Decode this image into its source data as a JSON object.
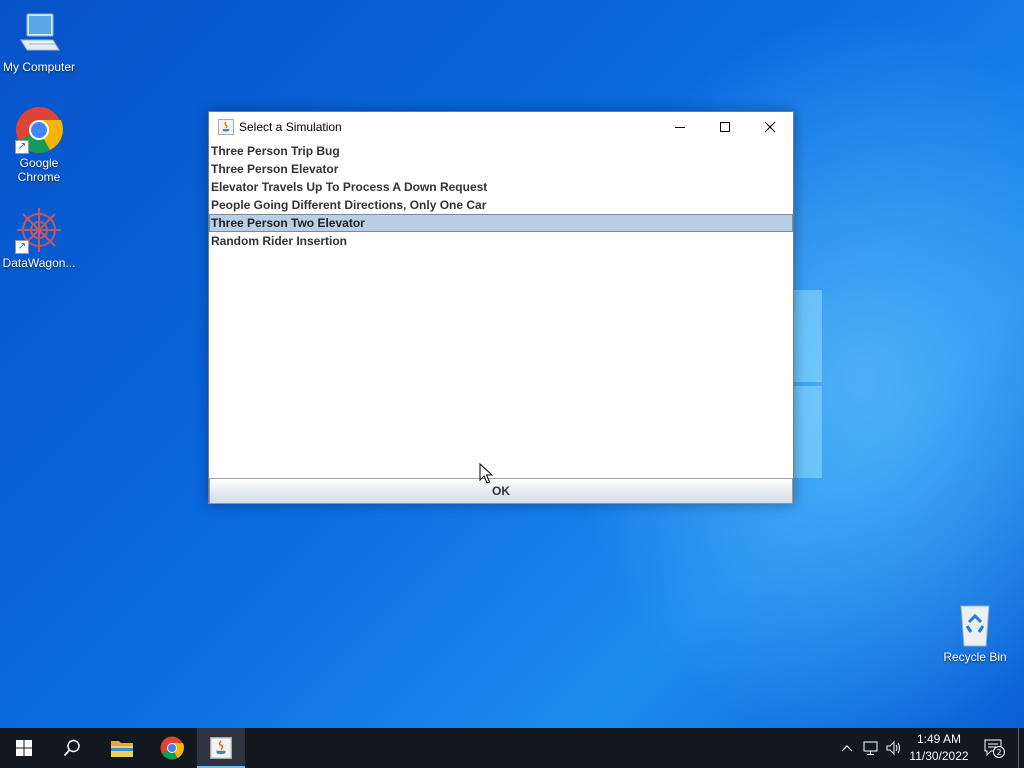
{
  "desktop": {
    "icons": [
      {
        "label": "My Computer",
        "icon": "computer-icon"
      },
      {
        "label": "Google Chrome",
        "icon": "chrome-icon"
      },
      {
        "label": "DataWagon...",
        "icon": "datawagon-icon"
      },
      {
        "label": "Recycle Bin",
        "icon": "recycle-bin-icon"
      }
    ]
  },
  "dialog": {
    "title": "Select a Simulation",
    "title_icon": "java-icon",
    "items": [
      {
        "label": "Three Person Trip Bug",
        "selected": false
      },
      {
        "label": "Three Person Elevator",
        "selected": false
      },
      {
        "label": "Elevator Travels Up To Process A Down Request",
        "selected": false
      },
      {
        "label": "People Going Different Directions, Only One Car",
        "selected": false
      },
      {
        "label": "Three Person Two Elevator",
        "selected": true
      },
      {
        "label": "Random Rider Insertion",
        "selected": false
      }
    ],
    "ok_label": "OK",
    "colors": {
      "selection": "#b8cfe5",
      "selection_border": "#7a8aa0"
    }
  },
  "taskbar": {
    "items": [
      "start-icon",
      "search-icon",
      "file-explorer-icon",
      "chrome-icon",
      "java-icon"
    ],
    "active_item": "java-icon",
    "clock": {
      "time": "1:49 AM",
      "date": "11/30/2022"
    },
    "notification_count": "2"
  },
  "colors": {
    "desktop_accent": "#0a63d8",
    "taskbar": "#101820"
  }
}
